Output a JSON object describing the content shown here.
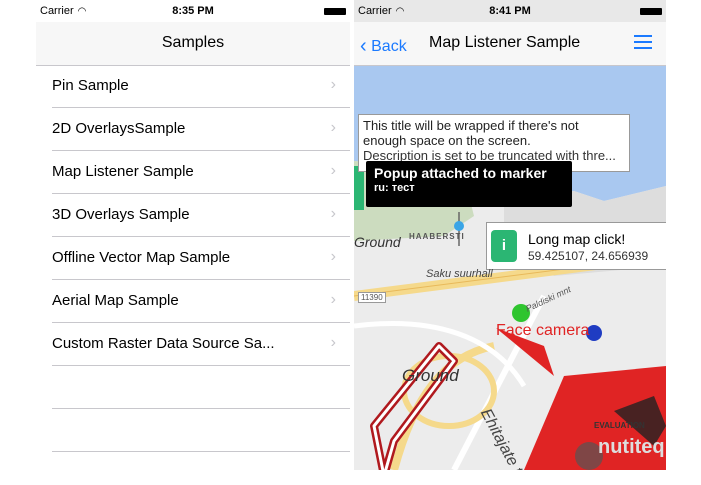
{
  "left_screen": {
    "status": {
      "carrier": "Carrier",
      "time": "8:35 PM"
    },
    "nav_title": "Samples",
    "items": [
      {
        "label": "Pin Sample"
      },
      {
        "label": "2D OverlaysSample"
      },
      {
        "label": "Map Listener Sample"
      },
      {
        "label": "3D Overlays Sample"
      },
      {
        "label": "Offline Vector Map Sample"
      },
      {
        "label": "Aerial Map Sample"
      },
      {
        "label": "Custom Raster Data Source Sa..."
      }
    ],
    "chevron": "›"
  },
  "right_screen": {
    "status": {
      "carrier": "Carrier",
      "time": "8:41 PM"
    },
    "back_label": "Back",
    "nav_title": "Map Listener Sample",
    "popup_wrapped": {
      "title": "This title will be wrapped if there's not enough space on the screen.",
      "description": "Description is set to be truncated with thre..."
    },
    "popup_marker": {
      "title": "Popup attached to marker",
      "description": "ru: тест"
    },
    "popup_click": {
      "info_glyph": "i",
      "title": "Long map click!",
      "coords": "59.425107, 24.656939"
    },
    "map_labels": {
      "ground_top": "Ground",
      "haabersti": "HAABERSTI",
      "saku": "Saku suurhall",
      "road_number": "11390",
      "paldiski": "Paldiski mnt",
      "face_camera": "Face camera",
      "ground_bottom": "Ground",
      "ehitajate": "Ehitajate te",
      "evaluation": "EVALUATION",
      "nutiteq": "nutiteq"
    },
    "colors": {
      "accent": "#1b7aff",
      "info_green": "#2bb673",
      "overlay_red": "#e02424",
      "water": "#a9c8f0"
    }
  }
}
